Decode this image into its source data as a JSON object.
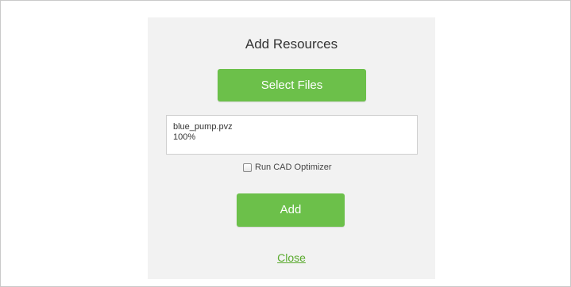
{
  "dialog": {
    "title": "Add Resources",
    "select_files_label": "Select Files",
    "file": {
      "name": "blue_pump.pvz",
      "progress_text": "100%"
    },
    "optimizer": {
      "label": "Run CAD Optimizer",
      "checked": false
    },
    "add_label": "Add",
    "close_label": "Close"
  },
  "colors": {
    "accent": "#6cc04a",
    "link": "#5aaa2e",
    "dialog_bg": "#f2f2f2"
  }
}
